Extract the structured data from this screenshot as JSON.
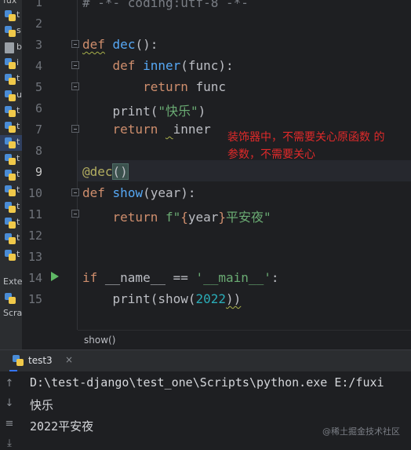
{
  "project_panel": {
    "title": "fux",
    "tree_letters": [
      "t",
      "s",
      "b",
      "i",
      "t",
      "u",
      "t",
      "t",
      "t",
      "t",
      "t",
      "t",
      "t",
      "t",
      "t",
      "t"
    ],
    "selected_index": 8,
    "bottom_items": [
      "Exte",
      "Scra"
    ]
  },
  "editor": {
    "line_numbers": [
      "1",
      "2",
      "3",
      "4",
      "5",
      "6",
      "7",
      "8",
      "9",
      "10",
      "11",
      "12",
      "13",
      "14",
      "15"
    ],
    "current_line": "9",
    "annotation": "装饰器中，不需要关心原函数 的\n参数，不需要关心"
  },
  "code": {
    "l1": "# -*- coding:utf-8 -*-",
    "l3_kw": "def",
    "l3_fn": "dec",
    "l3_rest": "():",
    "l4_kw": "def",
    "l4_fn": "inner",
    "l4_rest": "(func):",
    "l5_kw": "return",
    "l5_rest": " func",
    "l6_fn": "print",
    "l6_open": "(",
    "l6_str": "\"快乐\"",
    "l6_close": ")",
    "l7_kw": "return",
    "l7_rest": "inner",
    "l9_deco": "@dec",
    "l9_paren": "()",
    "l10_kw": "def",
    "l10_fn": "show",
    "l10_rest": "(year):",
    "l11_kw": "return",
    "l11_prefix": "f\"",
    "l11_brace_open": "{",
    "l11_var": "year",
    "l11_brace_close": "}",
    "l11_str": "平安夜\"",
    "l14_kw": "if",
    "l14_mid": " __name__ == ",
    "l14_str": "'__main__'",
    "l14_end": ":",
    "l15_a": "print(show(",
    "l15_num": "2022",
    "l15_b": "))"
  },
  "breadcrumb": "show()",
  "run": {
    "tab_label": "test3",
    "close_glyph": "×",
    "output": [
      "D:\\test-django\\test_one\\Scripts\\python.exe E:/fuxi",
      "快乐",
      "2022平安夜"
    ],
    "side_buttons": [
      "↑",
      "↓",
      "≡",
      "⤓"
    ],
    "watermark": "@稀土掘金技术社区"
  },
  "colors": {
    "keyword": "#cf8e6d",
    "function": "#56a8f5",
    "string": "#6aab73",
    "number": "#2aacb8",
    "decorator": "#b3ae60",
    "annotation": "#e02a2a",
    "run_icon": "#5fb865"
  }
}
